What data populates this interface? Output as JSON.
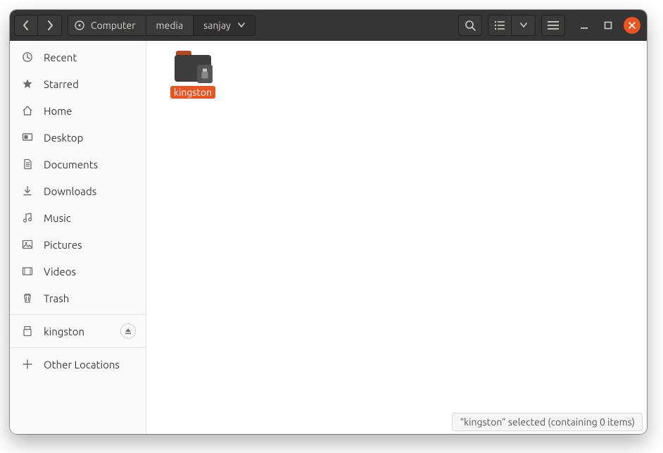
{
  "breadcrumb": {
    "root": "Computer",
    "seg1": "media",
    "seg2": "sanjay"
  },
  "sidebar": {
    "recent": "Recent",
    "starred": "Starred",
    "home": "Home",
    "desktop": "Desktop",
    "documents": "Documents",
    "downloads": "Downloads",
    "music": "Music",
    "pictures": "Pictures",
    "videos": "Videos",
    "trash": "Trash",
    "mount_kingston": "kingston",
    "other_locations": "Other Locations"
  },
  "content": {
    "items": [
      {
        "name": "kingston",
        "selected": true,
        "type": "usb-folder"
      }
    ]
  },
  "status": {
    "text": "“kingston” selected  (containing 0 items)"
  },
  "colors": {
    "accent": "#e95420",
    "header": "#353535",
    "sidebar": "#fafafa"
  },
  "icons": {
    "back": "chevron-left",
    "forward": "chevron-right",
    "disk": "disk",
    "search": "magnifier",
    "list_view": "list",
    "view_options": "chevron-down",
    "menu": "hamburger",
    "minimize": "minimize",
    "maximize": "maximize",
    "close": "close",
    "eject": "eject"
  }
}
